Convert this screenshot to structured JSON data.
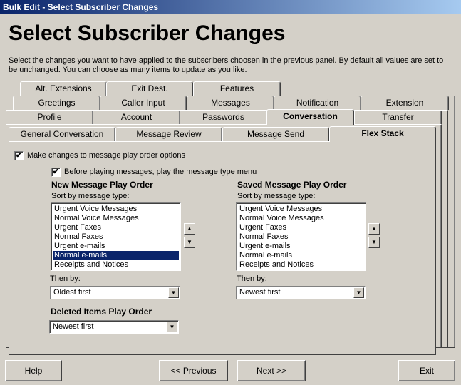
{
  "window": {
    "title": "Bulk Edit - Select Subscriber Changes"
  },
  "heading": "Select Subscriber Changes",
  "description": "Select the changes you want to have applied to the subscribers choosen in the previous panel.  By default all values are set to be unchanged.  You can choose as many items to update as you like.",
  "tabs": {
    "row1": [
      "Alt. Extensions",
      "Exit Dest.",
      "Features"
    ],
    "row2": [
      "Greetings",
      "Caller Input",
      "Messages",
      "Notification",
      "Extension"
    ],
    "row3": [
      "Profile",
      "Account",
      "Passwords",
      "Conversation",
      "Transfer"
    ],
    "active_main": "Conversation"
  },
  "subtabs": {
    "items": [
      "General Conversation",
      "Message Review",
      "Message Send",
      "Flex Stack"
    ],
    "active": "Flex Stack"
  },
  "flex": {
    "make_changes_label": "Make changes to message play order options",
    "make_changes_checked": true,
    "before_playing_label": "Before playing messages, play the message type menu",
    "before_playing_checked": true,
    "new_order": {
      "title": "New Message Play Order",
      "sort_label": "Sort by message type:",
      "items": [
        "Urgent Voice Messages",
        "Normal Voice Messages",
        "Urgent Faxes",
        "Normal Faxes",
        "Urgent e-mails",
        "Normal e-mails",
        "Receipts and Notices"
      ],
      "selected_index": 5,
      "then_by_label": "Then by:",
      "then_by_value": "Oldest first"
    },
    "saved_order": {
      "title": "Saved Message Play Order",
      "sort_label": "Sort by message type:",
      "items": [
        "Urgent Voice Messages",
        "Normal Voice Messages",
        "Urgent Faxes",
        "Normal Faxes",
        "Urgent e-mails",
        "Normal e-mails",
        "Receipts and Notices"
      ],
      "then_by_label": "Then by:",
      "then_by_value": "Newest first"
    },
    "deleted_order": {
      "title": "Deleted Items Play Order",
      "value": "Newest first"
    }
  },
  "buttons": {
    "help": "Help",
    "previous": "<< Previous",
    "next": "Next >>",
    "exit": "Exit"
  },
  "icons": {
    "check": "✔",
    "up": "▲",
    "down": "▼"
  },
  "colors": {
    "title_bar": "#0a246a",
    "selection": "#0a246a",
    "face": "#d4d0c8"
  }
}
